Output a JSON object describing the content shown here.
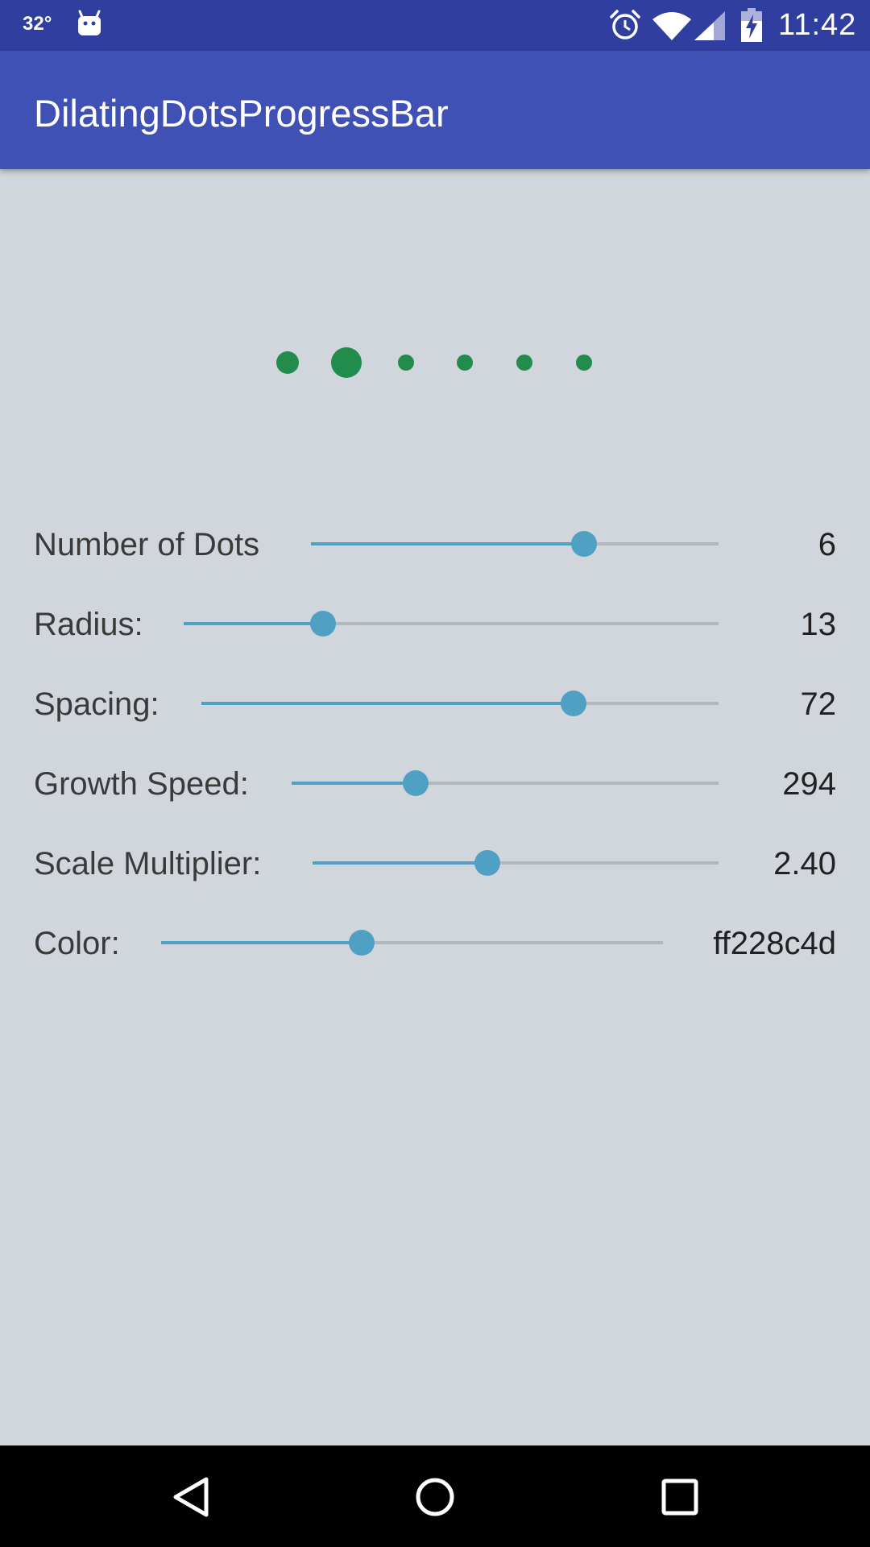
{
  "status_bar": {
    "temperature": "32°",
    "time": "11:42",
    "icons": [
      "android-icon",
      "alarm-icon",
      "wifi-icon",
      "signal-icon",
      "battery-charging-icon"
    ]
  },
  "app_bar": {
    "title": "DilatingDotsProgressBar",
    "color": "#3f51b5"
  },
  "progress": {
    "dot_color": "#228c4d",
    "dot_count": 6
  },
  "settings": [
    {
      "key": "dots",
      "label": "Number of Dots",
      "value": "6",
      "fraction": 0.67
    },
    {
      "key": "radius",
      "label": "Radius:",
      "value": "13",
      "fraction": 0.26
    },
    {
      "key": "spacing",
      "label": "Spacing:",
      "value": "72",
      "fraction": 0.72
    },
    {
      "key": "growth",
      "label": "Growth Speed:",
      "value": "294",
      "fraction": 0.29
    },
    {
      "key": "scale",
      "label": "Scale Multiplier:",
      "value": "2.40",
      "fraction": 0.43
    },
    {
      "key": "color",
      "label": "Color:",
      "value": "ff228c4d",
      "fraction": 0.4
    }
  ],
  "colors": {
    "slider_accent": "#4fa0c2",
    "background": "#d0d6dc",
    "status_bar": "#303f9f"
  },
  "nav_bar": {
    "icons": [
      "back-icon",
      "home-icon",
      "recents-icon"
    ]
  }
}
